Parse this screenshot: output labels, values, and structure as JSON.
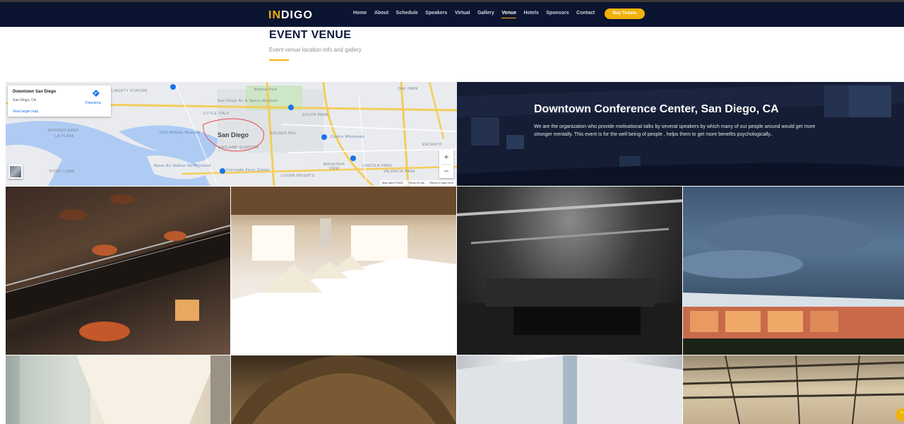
{
  "header": {
    "logo_accent": "IN",
    "logo_rest": "DIGO",
    "nav": [
      "Home",
      "About",
      "Schedule",
      "Speakers",
      "Virtual",
      "Gallery",
      "Venue",
      "Hotels",
      "Sponsors",
      "Contact"
    ],
    "active_nav": "Venue",
    "buy_label": "Buy Tickets"
  },
  "section": {
    "title": "EVENT VENUE",
    "subtitle": "Event venue location info and gallery"
  },
  "map": {
    "place_title": "Downtown San Diego",
    "place_sub": "San Diego, CA",
    "view_larger": "View larger map",
    "directions": "Directions",
    "city_label": "San Diego",
    "labels": {
      "gaslamp": "GASLAMP QUARTER",
      "balboa": "Balboa Park",
      "golden_hill": "GOLDEN HILL",
      "south_park": "SOUTH PARK",
      "costco": "Costco Wholesale",
      "point_loma": "POINT LOMA",
      "coronado": "Coronado Ferry Center",
      "naval": "Naval Air Station North Island",
      "mountain_view": "MOUNTAIN VIEW",
      "lincoln_park": "LINCOLN PARK",
      "encanto": "ENCANTO",
      "valencia": "VALENCIA PARK",
      "logan": "LOGAN HEIGHTS",
      "midway": "USS Midway Museum",
      "liberty": "LIBERTY STATION",
      "wooded": "WOODED AREA",
      "la_playa": "LA PLAYA",
      "little_italy": "LITTLE ITALY",
      "oak_park": "OAK PARK",
      "zoo": "San Diego Air & Space Museum"
    },
    "zoom_in": "+",
    "zoom_out": "−",
    "footer": [
      "Map data ©2020",
      "Terms of Use",
      "Report a map error"
    ]
  },
  "conference": {
    "title": "Downtown Conference Center, San Diego, CA",
    "description": "We are the organization who provide motivational talks by several speakers by which many of our people around would get more stronger mentally. This event is for the well being of people , helps them to get more benefits psychologically.."
  },
  "colors": {
    "accent": "#f1b10a",
    "navbar": "#0b1430",
    "title": "#0b1a3a"
  },
  "scroll_top_icon": "chevron-up-icon"
}
